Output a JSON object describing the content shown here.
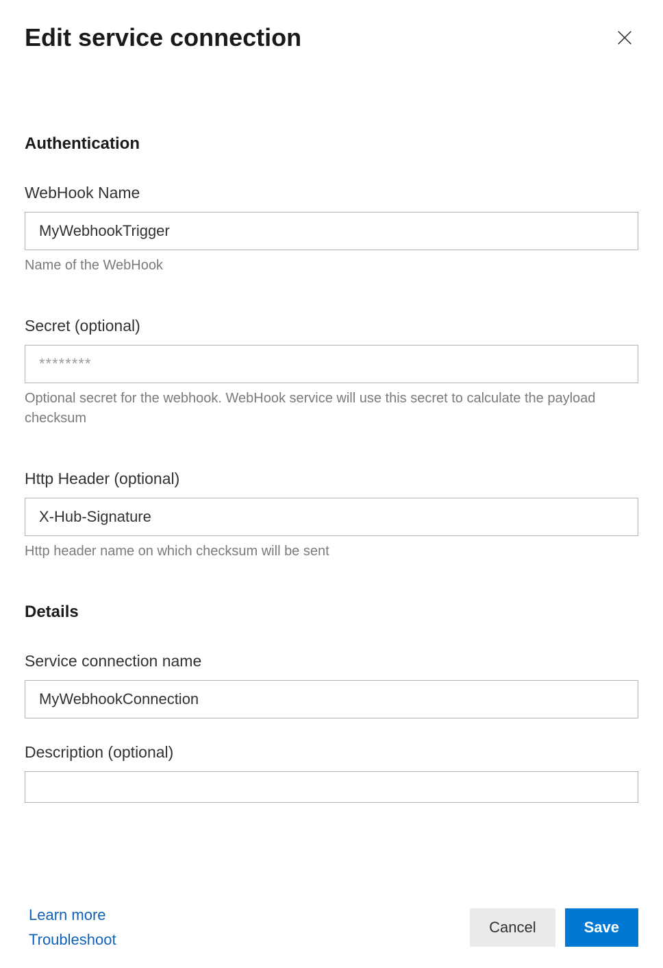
{
  "header": {
    "title": "Edit service connection"
  },
  "auth": {
    "heading": "Authentication",
    "webhook_name": {
      "label": "WebHook Name",
      "value": "MyWebhookTrigger",
      "help": "Name of the WebHook"
    },
    "secret": {
      "label": "Secret (optional)",
      "value": "",
      "placeholder": "********",
      "help": "Optional secret for the webhook. WebHook service will use this secret to calculate the payload checksum"
    },
    "http_header": {
      "label": "Http Header (optional)",
      "value": "X-Hub-Signature",
      "help": "Http header name on which checksum will be sent"
    }
  },
  "details": {
    "heading": "Details",
    "connection_name": {
      "label": "Service connection name",
      "value": "MyWebhookConnection"
    },
    "description": {
      "label": "Description (optional)",
      "value": ""
    }
  },
  "footer": {
    "learn_more": "Learn more",
    "troubleshoot": "Troubleshoot",
    "cancel": "Cancel",
    "save": "Save"
  }
}
